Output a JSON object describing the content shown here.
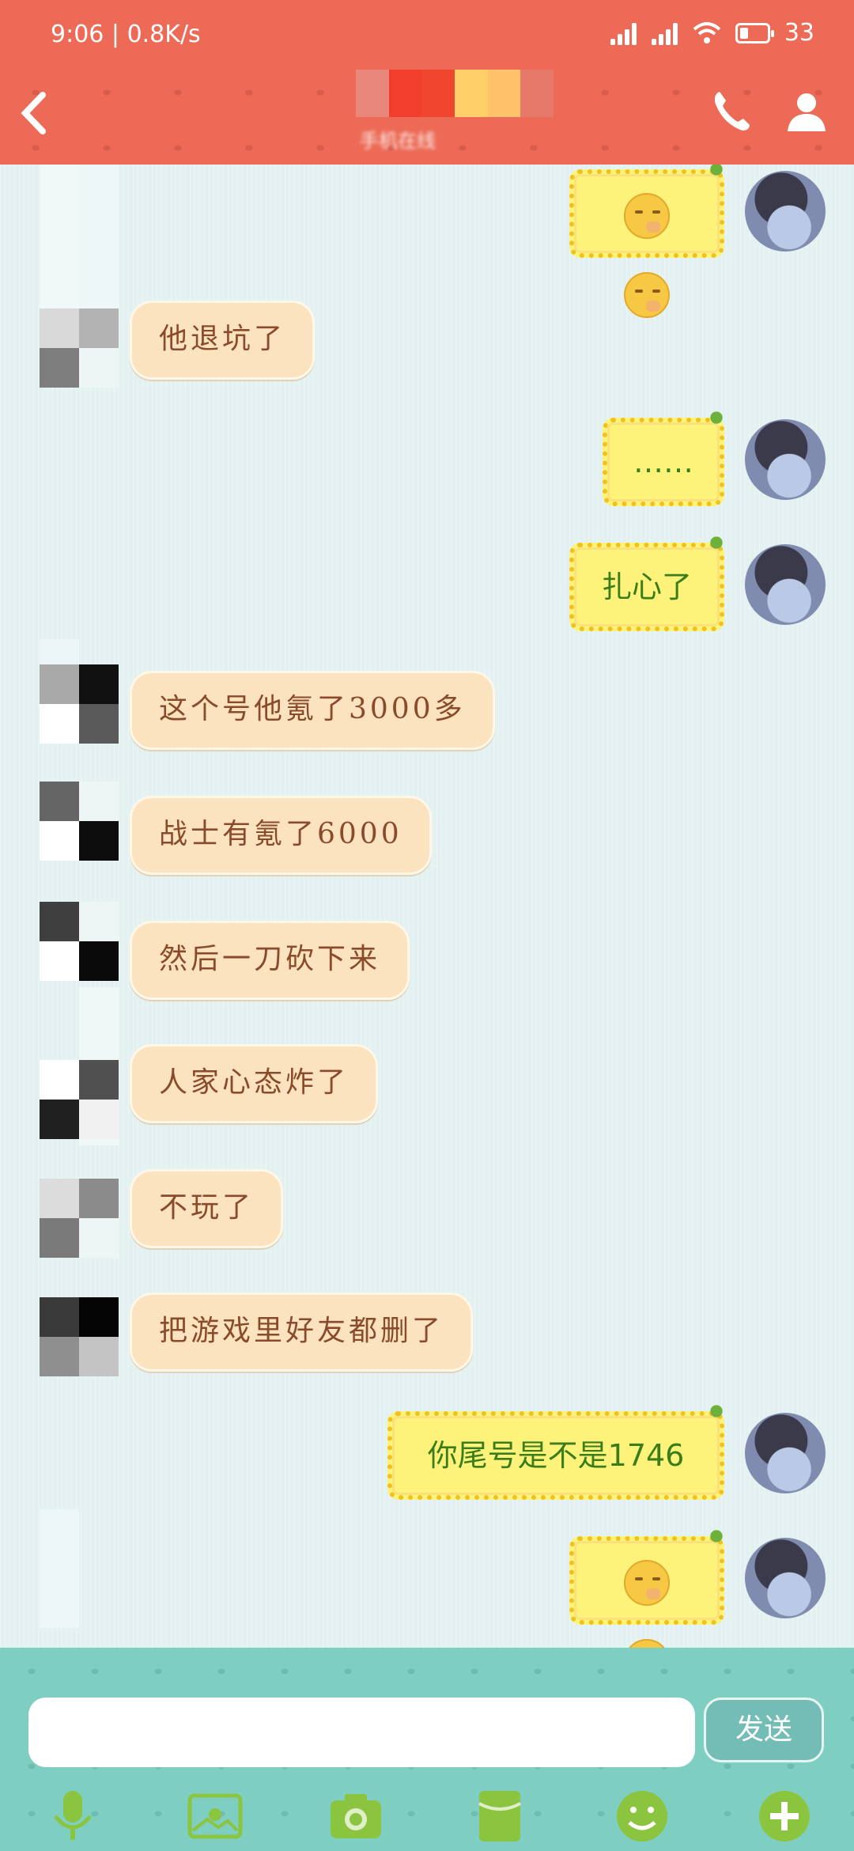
{
  "status_bar": {
    "time": "9:06",
    "network_speed": "0.8K/s",
    "battery": "33"
  },
  "header": {
    "subtitle": "手机在线"
  },
  "messages": [
    {
      "side": "out",
      "text": "",
      "type": "emoji",
      "emoji": "face-with-hand-over-mouth x2"
    },
    {
      "side": "in",
      "text": "他退坑了"
    },
    {
      "side": "out",
      "text": "……"
    },
    {
      "side": "out",
      "text": "扎心了"
    },
    {
      "side": "in",
      "text": "这个号他氪了3000多"
    },
    {
      "side": "in",
      "text": "战士有氪了6000"
    },
    {
      "side": "in",
      "text": "然后一刀砍下来"
    },
    {
      "side": "in",
      "text": "人家心态炸了"
    },
    {
      "side": "in",
      "text": "不玩了"
    },
    {
      "side": "in",
      "text": "把游戏里好友都删了"
    },
    {
      "side": "out",
      "text": "你尾号是不是1746"
    },
    {
      "side": "out",
      "text": "",
      "type": "emoji",
      "emoji": "face-with-hand-over-mouth x2"
    }
  ],
  "composer": {
    "input_value": "",
    "send_label": "发送"
  },
  "toolbar_icons": [
    "microphone-icon",
    "image-icon",
    "camera-icon",
    "red-packet-icon",
    "smiley-icon",
    "plus-icon"
  ],
  "colors": {
    "header": "#ec6a56",
    "chat_bg": "#e4f1f1",
    "incoming_bubble": "#fbe3bf",
    "outgoing_bubble": "#fdf27a",
    "bottom_bar": "#7fcec2"
  }
}
